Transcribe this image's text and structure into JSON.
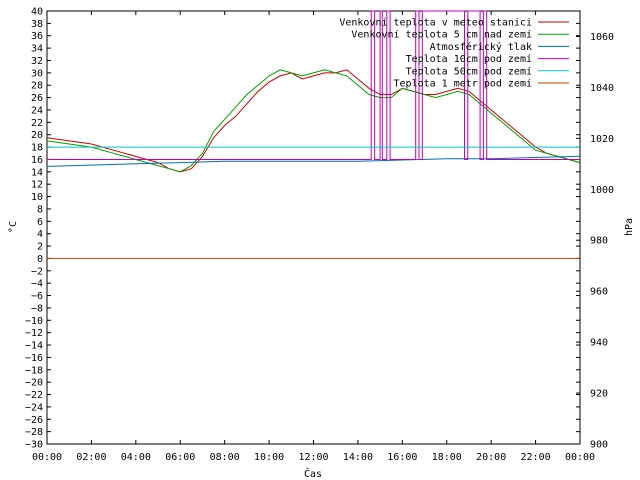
{
  "chart_data": {
    "type": "line",
    "title": "",
    "xlabel": "Čas",
    "ylabel_left": "°C",
    "ylabel_right": "hPa",
    "xlim": [
      0,
      24
    ],
    "ylim_left": [
      -30,
      40
    ],
    "ylim_right": [
      900,
      1070
    ],
    "x_ticks": [
      0,
      2,
      4,
      6,
      8,
      10,
      12,
      14,
      16,
      18,
      20,
      22,
      24
    ],
    "x_tick_labels": [
      "00:00",
      "02:00",
      "04:00",
      "06:00",
      "08:00",
      "10:00",
      "12:00",
      "14:00",
      "16:00",
      "18:00",
      "20:00",
      "22:00",
      "00:00"
    ],
    "y_left_ticks": [
      40,
      38,
      36,
      34,
      32,
      30,
      28,
      26,
      24,
      22,
      20,
      18,
      16,
      14,
      12,
      10,
      8,
      6,
      4,
      2,
      0,
      -2,
      -4,
      -6,
      -8,
      -10,
      -12,
      -14,
      -16,
      -18,
      -20,
      -22,
      -24,
      -26,
      -28,
      -30
    ],
    "y_left_tick_labels": [
      "40",
      "38",
      "36",
      "34",
      "32",
      "30",
      "28",
      "26",
      "24",
      "22",
      "20",
      "18",
      "16",
      "14",
      "12",
      "10",
      "8",
      "6",
      "4",
      "2",
      "0",
      "−2",
      "−4",
      "−6",
      "−8",
      "−10",
      "−12",
      "−14",
      "−16",
      "−18",
      "−20",
      "−22",
      "−24",
      "−26",
      "−28",
      "−30"
    ],
    "y_right_ticks": [
      1060,
      1040,
      1020,
      1000,
      980,
      960,
      940,
      920,
      900
    ],
    "y_right_tick_labels": [
      "1060",
      "1040",
      "1020",
      "1000",
      "980",
      "960",
      "940",
      "920",
      "900"
    ],
    "grid": false,
    "legend_position": "top-right",
    "series": [
      {
        "name": "Venkovní teplota v meteo stanici",
        "color": "#cc0000",
        "axis": "left",
        "x": [
          0,
          1,
          2,
          3,
          4,
          5,
          5.5,
          6,
          6.5,
          7,
          7.5,
          8,
          8.5,
          9,
          9.5,
          10,
          10.5,
          11,
          11.5,
          12,
          12.5,
          13,
          13.5,
          14,
          14.5,
          15,
          15.5,
          16,
          16.5,
          17,
          17.5,
          18,
          18.5,
          19,
          19.5,
          20,
          20.5,
          21,
          21.5,
          22,
          22.5,
          23,
          23.5,
          24
        ],
        "y": [
          19.5,
          19,
          18.5,
          17.5,
          16.5,
          15.5,
          14.5,
          14,
          14.5,
          16.5,
          19.5,
          21.5,
          23,
          25,
          27,
          28.5,
          29.5,
          30,
          29,
          29.5,
          30,
          30,
          30.5,
          29,
          27.5,
          26.5,
          26.5,
          27.5,
          27,
          26.5,
          26.5,
          27,
          27.5,
          27,
          25.5,
          24,
          22.5,
          21,
          19.5,
          18,
          17,
          16.5,
          16,
          15.5
        ]
      },
      {
        "name": "Venkovní teplota 5 cm nad zemí",
        "color": "#00a000",
        "axis": "left",
        "x": [
          0,
          1,
          2,
          3,
          4,
          5,
          5.5,
          6,
          6.5,
          7,
          7.5,
          8,
          8.5,
          9,
          9.5,
          10,
          10.5,
          11,
          11.5,
          12,
          12.5,
          13,
          13.5,
          14,
          14.5,
          15,
          15.5,
          16,
          16.5,
          17,
          17.5,
          18,
          18.5,
          19,
          19.5,
          20,
          20.5,
          21,
          21.5,
          22,
          22.5,
          23,
          23.5,
          24
        ],
        "y": [
          19,
          18.5,
          18,
          17,
          16,
          15,
          14.5,
          14,
          15,
          17,
          20.5,
          22.5,
          24.5,
          26.5,
          28,
          29.5,
          30.5,
          30,
          29.5,
          30,
          30.5,
          30,
          29.5,
          28,
          26.5,
          26,
          26,
          27.5,
          27,
          26.5,
          26,
          26.5,
          27,
          26.5,
          25,
          23.5,
          22,
          20.5,
          19,
          17.5,
          17,
          16.5,
          16,
          15.5
        ]
      },
      {
        "name": "Atmosférický tlak",
        "color": "#0070b0",
        "axis": "right",
        "x": [
          0,
          2,
          4,
          6,
          8,
          10,
          12,
          14,
          16,
          18,
          20,
          22,
          24
        ],
        "y": [
          1009,
          1009.5,
          1010,
          1010.5,
          1011,
          1011,
          1011,
          1011,
          1011.5,
          1012,
          1012,
          1012.5,
          1013
        ]
      },
      {
        "name": "Teplota 10cm pod zemí",
        "color": "#c000c0",
        "axis": "left",
        "x": [
          0,
          14.6,
          14.6,
          14.75,
          14.75,
          15.0,
          15.0,
          15.1,
          15.1,
          15.3,
          15.3,
          15.45,
          15.45,
          16.6,
          16.6,
          16.75,
          16.75,
          16.9,
          16.9,
          18.8,
          18.8,
          18.95,
          18.95,
          19.5,
          19.5,
          19.65,
          19.65,
          19.8,
          19.8,
          19.95,
          19.95,
          24
        ],
        "y": [
          16,
          16,
          40,
          40,
          16,
          16,
          40,
          40,
          16,
          16,
          40,
          40,
          16,
          16,
          40,
          40,
          16,
          16,
          40,
          40,
          16,
          16,
          40,
          40,
          16,
          16,
          40,
          40,
          16,
          16,
          16,
          16
        ]
      },
      {
        "name": "Teplota 50cm pod zemí",
        "color": "#00c8c8",
        "axis": "left",
        "x": [
          0,
          24
        ],
        "y": [
          18,
          18
        ]
      },
      {
        "name": "Teplota 1 metr pod zemí",
        "color": "#c84000",
        "axis": "left",
        "x": [
          0,
          24
        ],
        "y": [
          0,
          0
        ]
      }
    ]
  }
}
